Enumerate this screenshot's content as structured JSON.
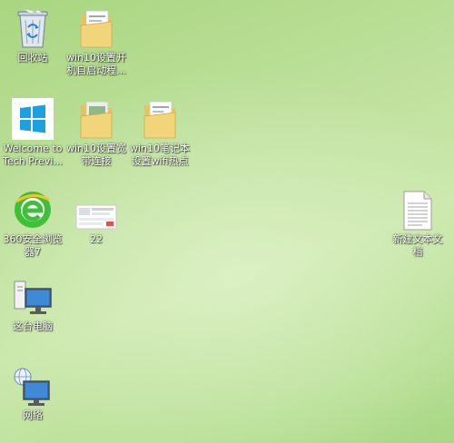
{
  "desktop": {
    "wallpaper_colors": [
      "#a9d680",
      "#cbe8ac",
      "#a8d784"
    ],
    "icons": [
      {
        "name": "recycle-bin",
        "label": "回收站",
        "icon": "recycle-bin-icon"
      },
      {
        "name": "folder-win10-startup",
        "label": "win10设置开\n机自启动程...",
        "icon": "folder-icon"
      },
      {
        "name": "welcome-tech-preview",
        "label": "Welcome to\nTech Previ...",
        "icon": "windows-logo-icon"
      },
      {
        "name": "folder-win10-broadband",
        "label": "win10设置宽\n带连接",
        "icon": "folder-icon"
      },
      {
        "name": "folder-win10-laptop-wifi",
        "label": "win10笔记本\n设置wifi热点",
        "icon": "folder-icon"
      },
      {
        "name": "browser-360",
        "label": "360安全浏览\n器7",
        "icon": "360-browser-icon"
      },
      {
        "name": "file-22",
        "label": "22",
        "icon": "image-file-icon"
      },
      {
        "name": "new-text-document",
        "label": "新建文本文\n档",
        "icon": "text-document-icon"
      },
      {
        "name": "this-pc",
        "label": "这台电脑",
        "icon": "computer-icon"
      },
      {
        "name": "network",
        "label": "网络",
        "icon": "network-icon"
      }
    ]
  }
}
